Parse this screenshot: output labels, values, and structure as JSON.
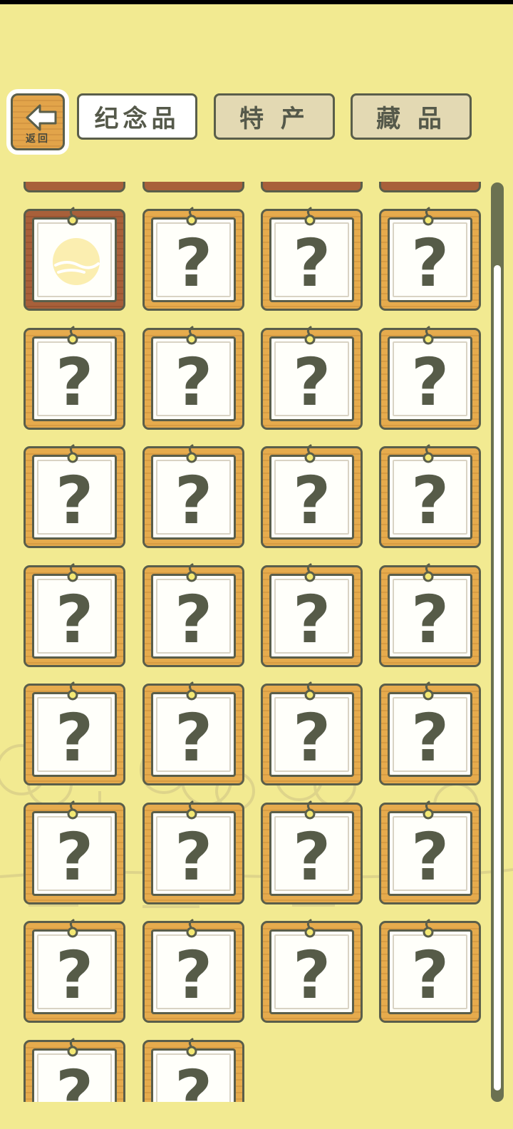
{
  "header": {
    "back_label": "返回",
    "tabs": [
      {
        "label": "纪念品",
        "active": true
      },
      {
        "label": "特 产",
        "active": false
      },
      {
        "label": "藏 品",
        "active": false
      }
    ]
  },
  "grid": {
    "unknown_symbol": "?",
    "items": [
      {
        "state": "found",
        "icon": "moon-icon"
      },
      {
        "state": "unknown"
      },
      {
        "state": "unknown"
      },
      {
        "state": "unknown"
      },
      {
        "state": "unknown"
      },
      {
        "state": "unknown"
      },
      {
        "state": "unknown"
      },
      {
        "state": "unknown"
      },
      {
        "state": "unknown"
      },
      {
        "state": "unknown"
      },
      {
        "state": "unknown"
      },
      {
        "state": "unknown"
      },
      {
        "state": "unknown"
      },
      {
        "state": "unknown"
      },
      {
        "state": "unknown"
      },
      {
        "state": "unknown"
      },
      {
        "state": "unknown"
      },
      {
        "state": "unknown"
      },
      {
        "state": "unknown"
      },
      {
        "state": "unknown"
      },
      {
        "state": "unknown"
      },
      {
        "state": "unknown"
      },
      {
        "state": "unknown"
      },
      {
        "state": "unknown"
      },
      {
        "state": "unknown"
      },
      {
        "state": "unknown"
      },
      {
        "state": "unknown"
      },
      {
        "state": "unknown"
      },
      {
        "state": "unknown"
      },
      {
        "state": "unknown"
      }
    ]
  },
  "colors": {
    "background": "#f2ea91",
    "frame_wood": "#e6ab4d",
    "frame_found": "#a8603a",
    "outline": "#5a5e4a",
    "question_mark": "#565b48",
    "moon": "#fbeeb0"
  }
}
